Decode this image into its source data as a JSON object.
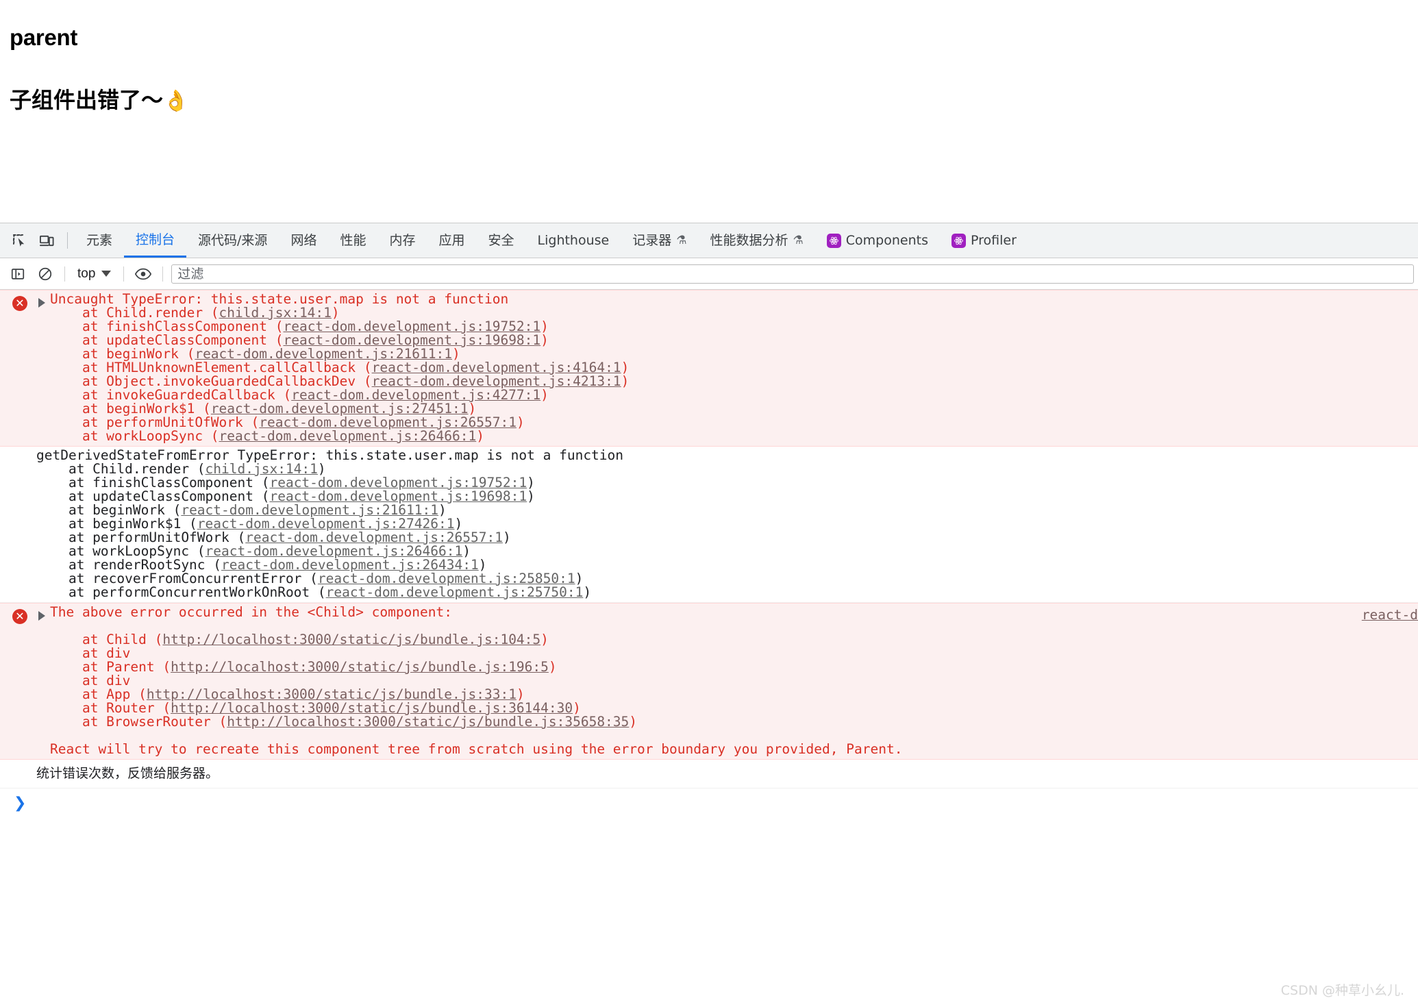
{
  "page": {
    "title": "parent",
    "subtitle": "子组件出错了～",
    "emoji": "👌"
  },
  "devtools": {
    "left_icons": [
      {
        "name": "inspect-element-icon",
        "label": "检查元素"
      },
      {
        "name": "device-toolbar-icon",
        "label": "切换设备工具栏"
      }
    ],
    "tabs": [
      {
        "label": "元素",
        "active": false,
        "icon": null
      },
      {
        "label": "控制台",
        "active": true,
        "icon": null
      },
      {
        "label": "源代码/来源",
        "active": false,
        "icon": null
      },
      {
        "label": "网络",
        "active": false,
        "icon": null
      },
      {
        "label": "性能",
        "active": false,
        "icon": null
      },
      {
        "label": "内存",
        "active": false,
        "icon": null
      },
      {
        "label": "应用",
        "active": false,
        "icon": null
      },
      {
        "label": "安全",
        "active": false,
        "icon": null
      },
      {
        "label": "Lighthouse",
        "active": false,
        "icon": null
      },
      {
        "label": "记录器",
        "active": false,
        "icon": "flask"
      },
      {
        "label": "性能数据分析",
        "active": false,
        "icon": "flask"
      },
      {
        "label": "Components",
        "active": false,
        "icon": "react"
      },
      {
        "label": "Profiler",
        "active": false,
        "icon": "react"
      }
    ],
    "flask_glyph": "⚗",
    "toolbar": {
      "sidebar_toggle_name": "console-sidebar-toggle",
      "clear_console_name": "clear-console-button",
      "context_value": "top",
      "eye_name": "live-expression-eye-icon",
      "filter_placeholder": "过滤",
      "filter_value": ""
    },
    "console": {
      "messages": [
        {
          "kind": "error",
          "header": "Uncaught TypeError: this.state.user.map is not a function",
          "source_link": "",
          "lines": [
            {
              "text": "    at Child.render (",
              "link": "child.jsx:14:1",
              "tail": ")"
            },
            {
              "text": "    at finishClassComponent (",
              "link": "react-dom.development.js:19752:1",
              "tail": ")"
            },
            {
              "text": "    at updateClassComponent (",
              "link": "react-dom.development.js:19698:1",
              "tail": ")"
            },
            {
              "text": "    at beginWork (",
              "link": "react-dom.development.js:21611:1",
              "tail": ")"
            },
            {
              "text": "    at HTMLUnknownElement.callCallback (",
              "link": "react-dom.development.js:4164:1",
              "tail": ")"
            },
            {
              "text": "    at Object.invokeGuardedCallbackDev (",
              "link": "react-dom.development.js:4213:1",
              "tail": ")"
            },
            {
              "text": "    at invokeGuardedCallback (",
              "link": "react-dom.development.js:4277:1",
              "tail": ")"
            },
            {
              "text": "    at beginWork$1 (",
              "link": "react-dom.development.js:27451:1",
              "tail": ")"
            },
            {
              "text": "    at performUnitOfWork (",
              "link": "react-dom.development.js:26557:1",
              "tail": ")"
            },
            {
              "text": "    at workLoopSync (",
              "link": "react-dom.development.js:26466:1",
              "tail": ")"
            }
          ]
        },
        {
          "kind": "plain",
          "header": "getDerivedStateFromError TypeError: this.state.user.map is not a function",
          "source_link": "",
          "lines": [
            {
              "text": "    at Child.render (",
              "link": "child.jsx:14:1",
              "tail": ")"
            },
            {
              "text": "    at finishClassComponent (",
              "link": "react-dom.development.js:19752:1",
              "tail": ")"
            },
            {
              "text": "    at updateClassComponent (",
              "link": "react-dom.development.js:19698:1",
              "tail": ")"
            },
            {
              "text": "    at beginWork (",
              "link": "react-dom.development.js:21611:1",
              "tail": ")"
            },
            {
              "text": "    at beginWork$1 (",
              "link": "react-dom.development.js:27426:1",
              "tail": ")"
            },
            {
              "text": "    at performUnitOfWork (",
              "link": "react-dom.development.js:26557:1",
              "tail": ")"
            },
            {
              "text": "    at workLoopSync (",
              "link": "react-dom.development.js:26466:1",
              "tail": ")"
            },
            {
              "text": "    at renderRootSync (",
              "link": "react-dom.development.js:26434:1",
              "tail": ")"
            },
            {
              "text": "    at recoverFromConcurrentError (",
              "link": "react-dom.development.js:25850:1",
              "tail": ")"
            },
            {
              "text": "    at performConcurrentWorkOnRoot (",
              "link": "react-dom.development.js:25750:1",
              "tail": ")"
            }
          ]
        },
        {
          "kind": "error",
          "header": "The above error occurred in the <Child> component:",
          "source_link": "react-d",
          "lines": [
            {
              "text": "",
              "link": "",
              "tail": ""
            },
            {
              "text": "    at Child (",
              "link": "http://localhost:3000/static/js/bundle.js:104:5",
              "tail": ")"
            },
            {
              "text": "    at div",
              "link": "",
              "tail": ""
            },
            {
              "text": "    at Parent (",
              "link": "http://localhost:3000/static/js/bundle.js:196:5",
              "tail": ")"
            },
            {
              "text": "    at div",
              "link": "",
              "tail": ""
            },
            {
              "text": "    at App (",
              "link": "http://localhost:3000/static/js/bundle.js:33:1",
              "tail": ")"
            },
            {
              "text": "    at Router (",
              "link": "http://localhost:3000/static/js/bundle.js:36144:30",
              "tail": ")"
            },
            {
              "text": "    at BrowserRouter (",
              "link": "http://localhost:3000/static/js/bundle.js:35658:35",
              "tail": ")"
            },
            {
              "text": "",
              "link": "",
              "tail": ""
            },
            {
              "text": "React will try to recreate this component tree from scratch using the error boundary you provided, Parent.",
              "link": "",
              "tail": ""
            }
          ]
        }
      ],
      "log_message": "统计错误次数，反馈给服务器。",
      "prompt_glyph": "❯"
    }
  },
  "watermark": "CSDN @种草小幺儿."
}
